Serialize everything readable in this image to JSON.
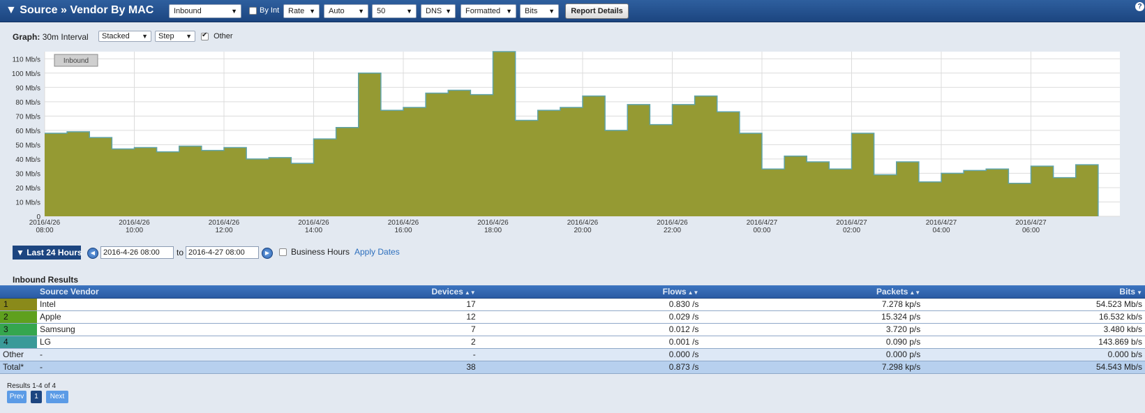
{
  "header": {
    "title": "▼ Source » Vendor By MAC",
    "direction": "Inbound",
    "by_int": "By Int",
    "mode": "Rate",
    "scale": "Auto",
    "count": "50",
    "resolve": "DNS",
    "format": "Formatted",
    "unit": "Bits",
    "report_details": "Report Details",
    "help": "?"
  },
  "graph": {
    "label": "Graph:",
    "interval": "30m Interval",
    "style": "Stacked",
    "line": "Step",
    "other": "Other"
  },
  "chart_data": {
    "type": "area",
    "step": true,
    "stacked": true,
    "legend": "Inbound",
    "y_ticks": [
      "0",
      "10 Mb/s",
      "20 Mb/s",
      "30 Mb/s",
      "40 Mb/s",
      "50 Mb/s",
      "60 Mb/s",
      "70 Mb/s",
      "80 Mb/s",
      "90 Mb/s",
      "100 Mb/s",
      "110 Mb/s"
    ],
    "ylim": [
      0,
      115
    ],
    "x_ticks": [
      {
        "date": "2016/4/26",
        "time": "08:00"
      },
      {
        "date": "2016/4/26",
        "time": "10:00"
      },
      {
        "date": "2016/4/26",
        "time": "12:00"
      },
      {
        "date": "2016/4/26",
        "time": "14:00"
      },
      {
        "date": "2016/4/26",
        "time": "16:00"
      },
      {
        "date": "2016/4/26",
        "time": "18:00"
      },
      {
        "date": "2016/4/26",
        "time": "20:00"
      },
      {
        "date": "2016/4/26",
        "time": "22:00"
      },
      {
        "date": "2016/4/27",
        "time": "00:00"
      },
      {
        "date": "2016/4/27",
        "time": "02:00"
      },
      {
        "date": "2016/4/27",
        "time": "04:00"
      },
      {
        "date": "2016/4/27",
        "time": "06:00"
      }
    ],
    "values_mbps": [
      58,
      59,
      55,
      47,
      48,
      45,
      49,
      46,
      48,
      40,
      41,
      37,
      54,
      62,
      100,
      74,
      76,
      86,
      88,
      85,
      115,
      67,
      74,
      76,
      84,
      60,
      78,
      64,
      78,
      84,
      73,
      58,
      33,
      42,
      38,
      33,
      58,
      29,
      38,
      24,
      30,
      32,
      33,
      23,
      35,
      27,
      36
    ],
    "colors": {
      "fill": "#959a33",
      "stroke": "#5fa3a8"
    }
  },
  "dates": {
    "preset": "▼ Last 24 Hours",
    "start": "2016-4-26 08:00",
    "to": "to",
    "end": "2016-4-27 08:00",
    "business_hours": "Business Hours",
    "apply": "Apply Dates"
  },
  "results": {
    "title": "Inbound Results",
    "columns": {
      "vendor": "Source Vendor",
      "devices": "Devices",
      "flows": "Flows",
      "packets": "Packets",
      "bits": "Bits"
    },
    "rows": [
      {
        "rank": "1",
        "vendor": "Intel",
        "devices": "17",
        "flows": "0.830 /s",
        "packets": "7.278 kp/s",
        "bits": "54.523 Mb/s",
        "color": "#8a8a1a"
      },
      {
        "rank": "2",
        "vendor": "Apple",
        "devices": "12",
        "flows": "0.029 /s",
        "packets": "15.324 p/s",
        "bits": "16.532 kb/s",
        "color": "#5fa01e"
      },
      {
        "rank": "3",
        "vendor": "Samsung",
        "devices": "7",
        "flows": "0.012 /s",
        "packets": "3.720 p/s",
        "bits": "3.480 kb/s",
        "color": "#35a64e"
      },
      {
        "rank": "4",
        "vendor": "LG",
        "devices": "2",
        "flows": "0.001 /s",
        "packets": "0.090 p/s",
        "bits": "143.869 b/s",
        "color": "#3a9a99"
      }
    ],
    "other": {
      "label": "Other",
      "vendor": "-",
      "devices": "-",
      "flows": "0.000 /s",
      "packets": "0.000 p/s",
      "bits": "0.000 b/s"
    },
    "total": {
      "label": "Total*",
      "vendor": "-",
      "devices": "38",
      "flows": "0.873 /s",
      "packets": "7.298 kp/s",
      "bits": "54.543 Mb/s"
    }
  },
  "paging": {
    "count": "Results 1-4 of 4",
    "prev": "Prev",
    "page": "1",
    "next": "Next"
  }
}
